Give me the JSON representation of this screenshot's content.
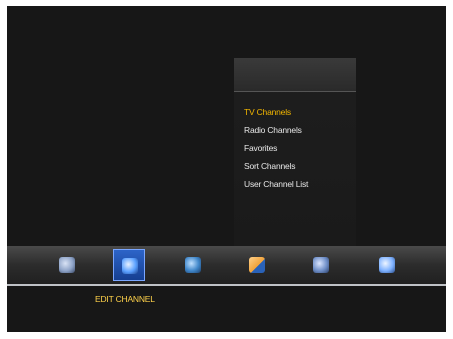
{
  "submenu": {
    "items": [
      {
        "label": "TV Channels",
        "active": true
      },
      {
        "label": "Radio Channels",
        "active": false
      },
      {
        "label": "Favorites",
        "active": false
      },
      {
        "label": "Sort Channels",
        "active": false
      },
      {
        "label": "User Channel List",
        "active": false
      }
    ]
  },
  "main_menu": {
    "selected_label": "EDIT CHANNEL",
    "icons": [
      {
        "name": "installation-icon",
        "color": "#8fa4c8"
      },
      {
        "name": "edit-channel-icon",
        "color": "#5aa0ff"
      },
      {
        "name": "system-setup-icon",
        "color": "#3f86c9"
      },
      {
        "name": "multimedia-icon",
        "color": "#f0a23a"
      },
      {
        "name": "tools-icon",
        "color": "#6f8fc8"
      },
      {
        "name": "games-icon",
        "color": "#7fb2ff"
      }
    ]
  },
  "colors": {
    "active_text": "#f2b600",
    "label_text": "#ffd24a",
    "selected_slot": "#2d64c8"
  }
}
